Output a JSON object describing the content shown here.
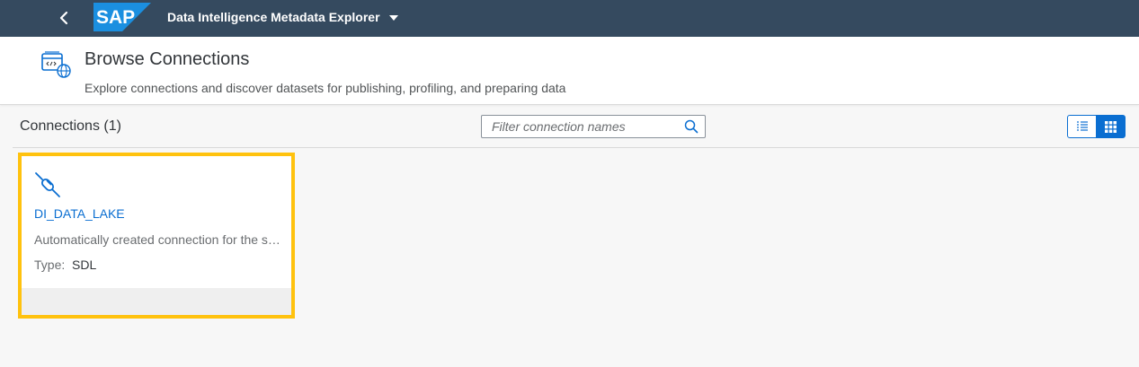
{
  "shell": {
    "logo_text": "SAP",
    "app_title": "Data Intelligence Metadata Explorer",
    "colors": {
      "bar": "#354a5f",
      "logo": "#1b8fe0"
    }
  },
  "header": {
    "title": "Browse Connections",
    "subtitle": "Explore connections and discover datasets for publishing, profiling, and preparing data",
    "icon": "browse-connections-icon"
  },
  "toolbar": {
    "title": "Connections (1)",
    "search": {
      "placeholder": "Filter connection names",
      "value": ""
    },
    "views": [
      {
        "name": "list-view-icon",
        "selected": false
      },
      {
        "name": "grid-view-icon",
        "selected": true
      }
    ]
  },
  "connections": [
    {
      "name": "DI_DATA_LAKE",
      "description": "Automatically created connection for the system data lake",
      "type_label": "Type:",
      "type_value": "SDL",
      "icon": "connection-plug-icon",
      "highlighted": true
    }
  ],
  "colors": {
    "accent": "#0a6ed1",
    "highlight": "#ffc20e"
  }
}
